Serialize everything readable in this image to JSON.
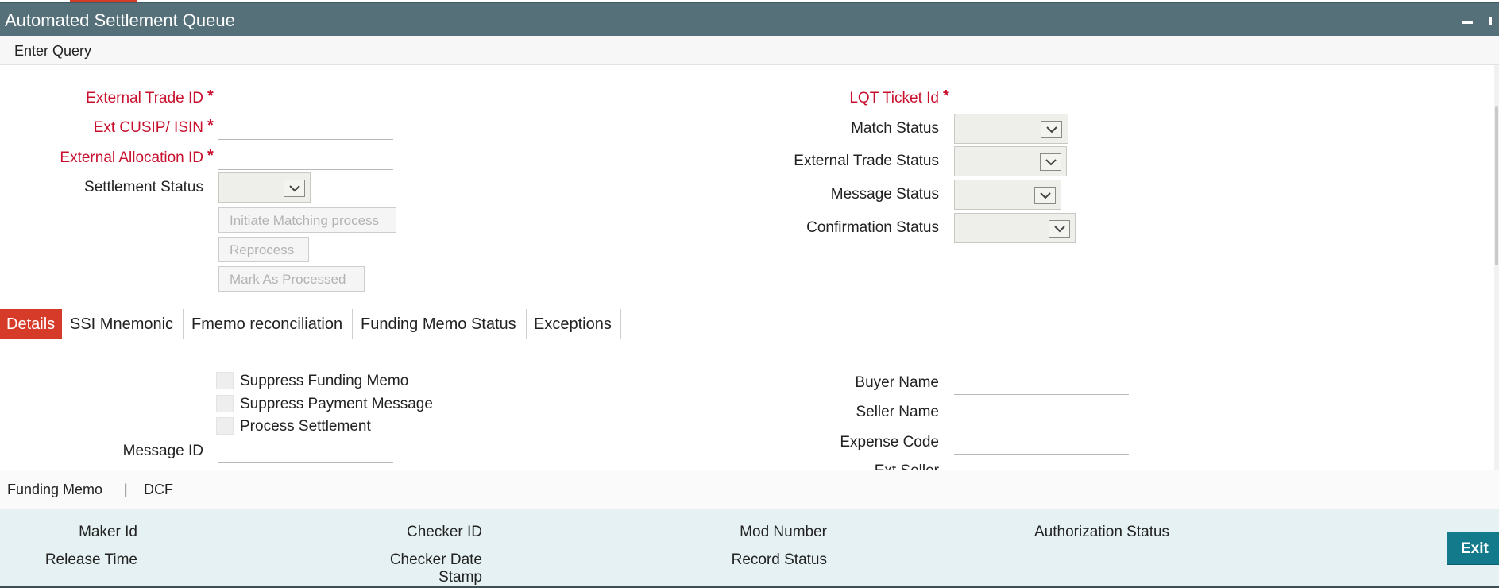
{
  "window": {
    "title": "Automated Settlement Queue"
  },
  "query_bar": {
    "label": "Enter Query"
  },
  "form": {
    "external_trade_id": {
      "label": "External Trade ID",
      "value": ""
    },
    "ext_cusip_isin": {
      "label": "Ext CUSIP/ ISIN",
      "value": ""
    },
    "external_allocation_id": {
      "label": "External Allocation ID",
      "value": ""
    },
    "settlement_status": {
      "label": "Settlement Status",
      "value": ""
    },
    "lqt_ticket_id": {
      "label": "LQT Ticket Id",
      "value": ""
    },
    "match_status": {
      "label": "Match Status",
      "value": ""
    },
    "external_trade_status": {
      "label": "External Trade Status",
      "value": ""
    },
    "message_status": {
      "label": "Message Status",
      "value": ""
    },
    "confirmation_status": {
      "label": "Confirmation Status",
      "value": ""
    },
    "required_mark": "*"
  },
  "buttons": {
    "initiate_matching": "Initiate Matching process",
    "reprocess": "Reprocess",
    "mark_processed": "Mark As Processed",
    "exit": "Exit"
  },
  "tabs": [
    {
      "label": "Details",
      "active": true
    },
    {
      "label": "SSI Mnemonic",
      "active": false
    },
    {
      "label": "Fmemo reconciliation",
      "active": false
    },
    {
      "label": "Funding Memo Status",
      "active": false
    },
    {
      "label": "Exceptions",
      "active": false
    }
  ],
  "details": {
    "checkboxes": [
      {
        "label": "Suppress Funding Memo",
        "checked": false
      },
      {
        "label": "Suppress Payment Message",
        "checked": false
      },
      {
        "label": "Process Settlement",
        "checked": false
      }
    ],
    "message_id": {
      "label": "Message ID",
      "value": ""
    },
    "buyer_name": {
      "label": "Buyer Name",
      "value": ""
    },
    "seller_name": {
      "label": "Seller Name",
      "value": ""
    },
    "expense_code": {
      "label": "Expense Code",
      "value": ""
    },
    "ext_seller": {
      "label": "Ext Seller"
    }
  },
  "subnav": {
    "funding_memo": "Funding Memo",
    "separator": "|",
    "dcf": "DCF"
  },
  "footer": {
    "maker_id": "Maker Id",
    "release_time": "Release Time",
    "checker_id": "Checker ID",
    "checker_date_stamp_line1": "Checker Date",
    "checker_date_stamp_line2": "Stamp",
    "mod_number": "Mod Number",
    "record_status": "Record Status",
    "authorization_status": "Authorization Status"
  },
  "colors": {
    "title_bar": "#557078",
    "accent_red": "#d63b2a",
    "required_red": "#c8102e",
    "footer_bg": "#e5f1f2",
    "exit_button": "#137a8c"
  }
}
